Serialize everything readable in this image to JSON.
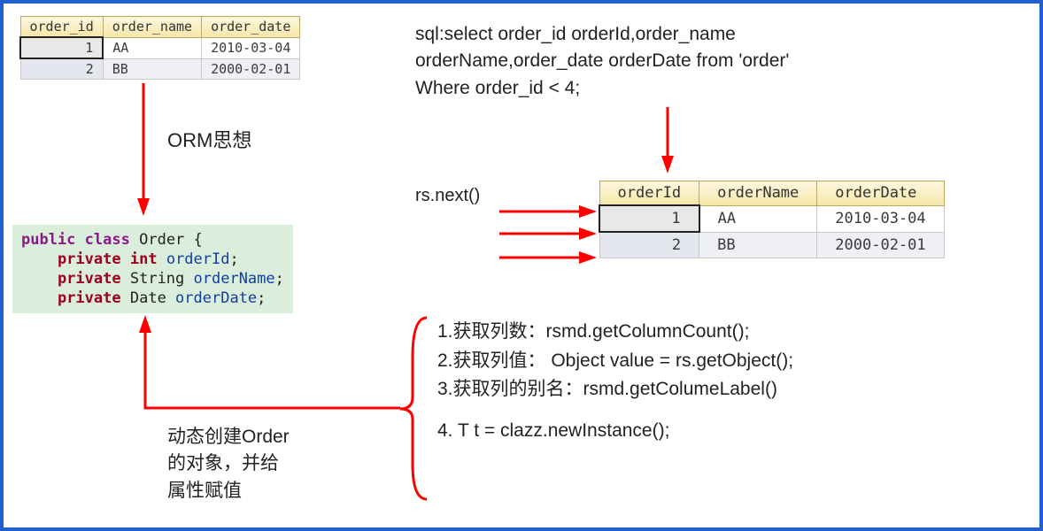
{
  "tables": {
    "top": {
      "headers": [
        "order_id",
        "order_name",
        "order_date"
      ],
      "rows": [
        {
          "id": "1",
          "name": "AA",
          "date": "2010-03-04",
          "selected": true
        },
        {
          "id": "2",
          "name": "BB",
          "date": "2000-02-01",
          "selected": false
        }
      ]
    },
    "right": {
      "headers": [
        "orderId",
        "orderName",
        "orderDate"
      ],
      "rows": [
        {
          "id": "1",
          "name": "AA",
          "date": "2010-03-04",
          "selected": true
        },
        {
          "id": "2",
          "name": "BB",
          "date": "2000-02-01",
          "selected": false
        }
      ]
    }
  },
  "labels": {
    "orm": "ORM思想",
    "rsnext": "rs.next()",
    "dynamic_line1": "动态创建Order",
    "dynamic_line2": "的对象，并给",
    "dynamic_line3": "属性赋值"
  },
  "sql": {
    "line1": "sql:select order_id orderId,order_name",
    "line2": "orderName,order_date orderDate from 'order'",
    "line3": "Where order_id < 4;"
  },
  "code": {
    "kw_public": "public",
    "kw_class": "class",
    "cls_name": "Order",
    "brace_open": " {",
    "kw_private": "private",
    "kw_int": "int",
    "fld_id": "orderId",
    "type_string": "String ",
    "fld_name": "orderName",
    "type_date": "Date ",
    "fld_date": "orderDate",
    "semi": ";",
    "indent": "    "
  },
  "steps": {
    "s1": "1.获取列数：rsmd.getColumnCount();",
    "s2": "2.获取列值： Object value = rs.getObject();",
    "s3": "3.获取列的别名：rsmd.getColumeLabel()",
    "s4": "4. T t =  clazz.newInstance();"
  }
}
